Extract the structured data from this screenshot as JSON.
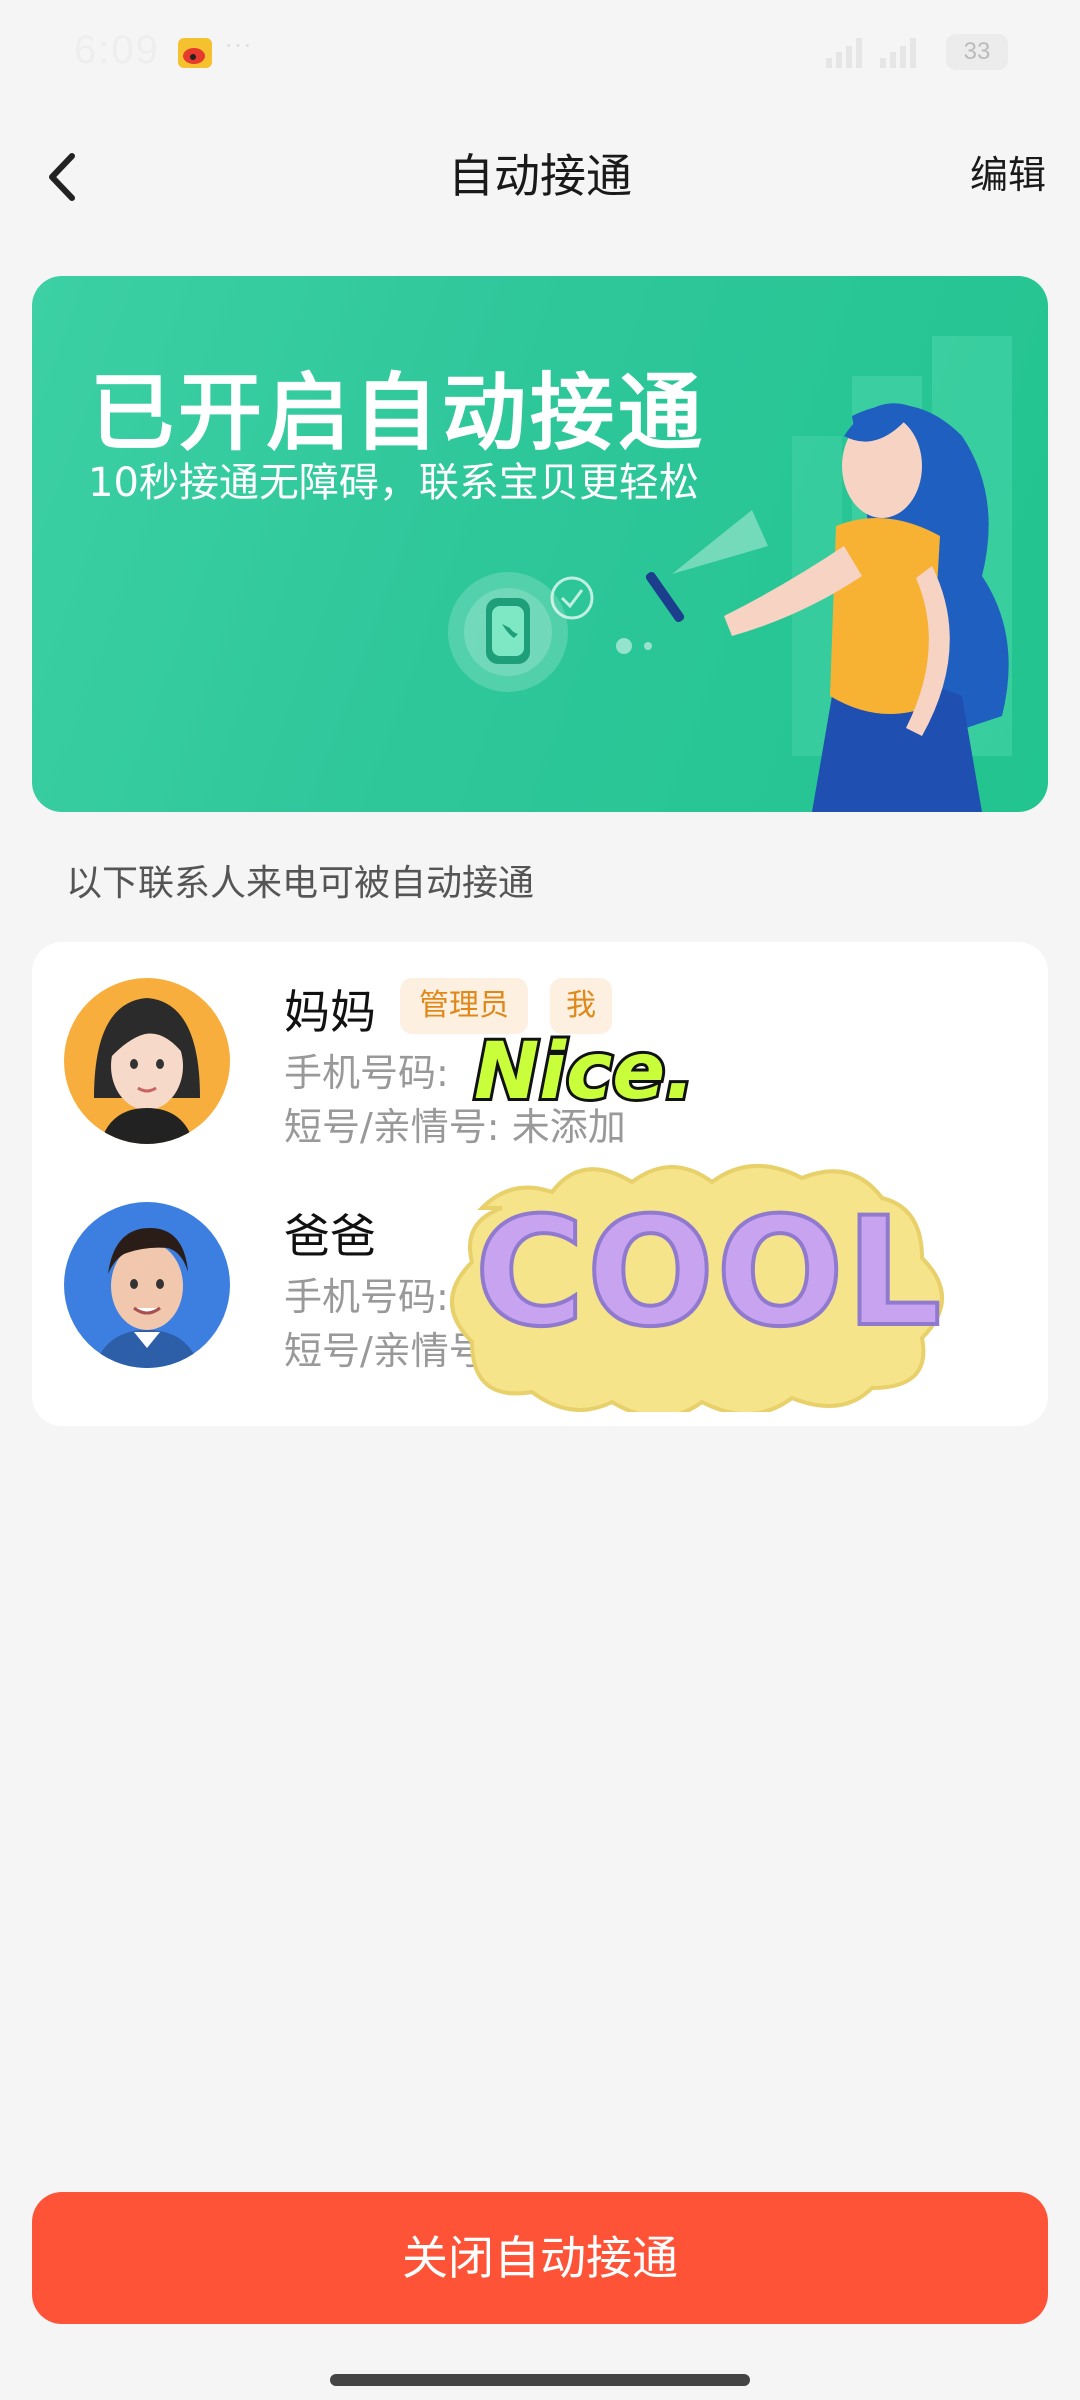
{
  "status_bar": {
    "time": "6:09",
    "dots": "···",
    "battery": "33"
  },
  "nav": {
    "title": "自动接通",
    "edit_label": "编辑"
  },
  "banner": {
    "title": "已开启自动接通",
    "subtitle": "10秒接通无障碍，联系宝贝更轻松"
  },
  "section": {
    "caption": "以下联系人来电可被自动接通"
  },
  "contacts": [
    {
      "name": "妈妈",
      "badges": [
        "管理员",
        "我"
      ],
      "phone_label": "手机号码:",
      "short_label": "短号/亲情号:",
      "short_value": "未添加"
    },
    {
      "name": "爸爸",
      "phone_label": "手机号码:",
      "short_label": "短号/亲情号:"
    }
  ],
  "stickers": {
    "nice": "Nice.",
    "cool": "COOL"
  },
  "footer": {
    "close_label": "关闭自动接通"
  },
  "colors": {
    "banner_green": "#2ec79a",
    "close_red": "#ff5337",
    "badge_orange": "#e0891a"
  }
}
